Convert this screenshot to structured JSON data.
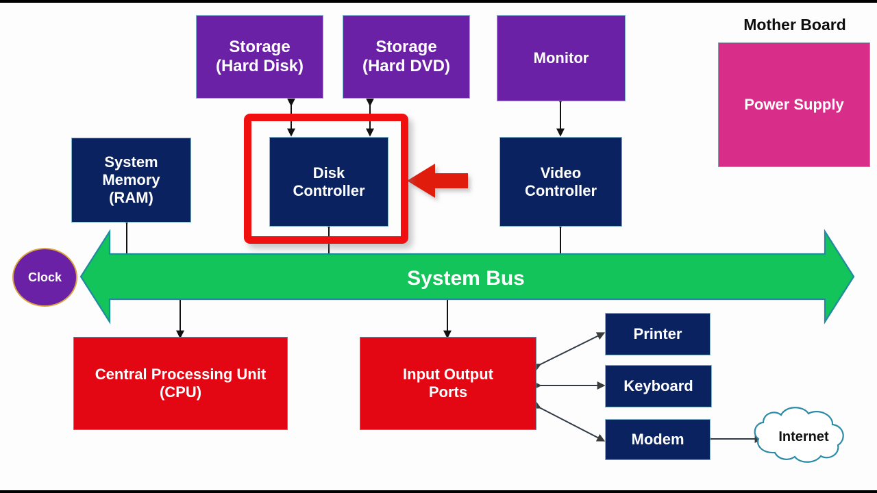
{
  "diagram": {
    "title_label": "Mother Board",
    "bus": {
      "label": "System Bus",
      "color": "#12c45a",
      "border_color": "#1f8aa0",
      "direction": "bidirectional"
    },
    "clock": {
      "label": "Clock",
      "fill": "#6a21a5",
      "border": "#d9a441"
    },
    "storage_devices": [
      {
        "id": "hard-disk",
        "label": "Storage\n(Hard Disk)",
        "color": "#6a21a5"
      },
      {
        "id": "hard-dvd",
        "label": "Storage\n(Hard DVD)",
        "color": "#6a21a5"
      },
      {
        "id": "monitor",
        "label": "Monitor",
        "color": "#6a21a5"
      }
    ],
    "controllers": [
      {
        "id": "system-memory",
        "label": "System\nMemory\n(RAM)",
        "color": "#0a2260"
      },
      {
        "id": "disk-controller",
        "label": "Disk\nController",
        "color": "#0a2260",
        "highlighted": true
      },
      {
        "id": "video-controller",
        "label": "Video\nController",
        "color": "#0a2260"
      }
    ],
    "processors": [
      {
        "id": "cpu",
        "label": "Central Processing Unit\n(CPU)",
        "color": "#e30613"
      },
      {
        "id": "io-ports",
        "label": "Input Output\nPorts",
        "color": "#e30613"
      }
    ],
    "peripherals": [
      {
        "id": "printer",
        "label": "Printer",
        "color": "#0a2260"
      },
      {
        "id": "keyboard",
        "label": "Keyboard",
        "color": "#0a2260"
      },
      {
        "id": "modem",
        "label": "Modem",
        "color": "#0a2260"
      }
    ],
    "power_supply": {
      "label": "Power Supply",
      "color": "#d92d8a"
    },
    "internet": {
      "label": "Internet",
      "outline_color": "#2b8aa6"
    },
    "pointer": {
      "name": "red-callout-arrow",
      "color": "#e01b10",
      "points_to": "disk-controller"
    }
  }
}
